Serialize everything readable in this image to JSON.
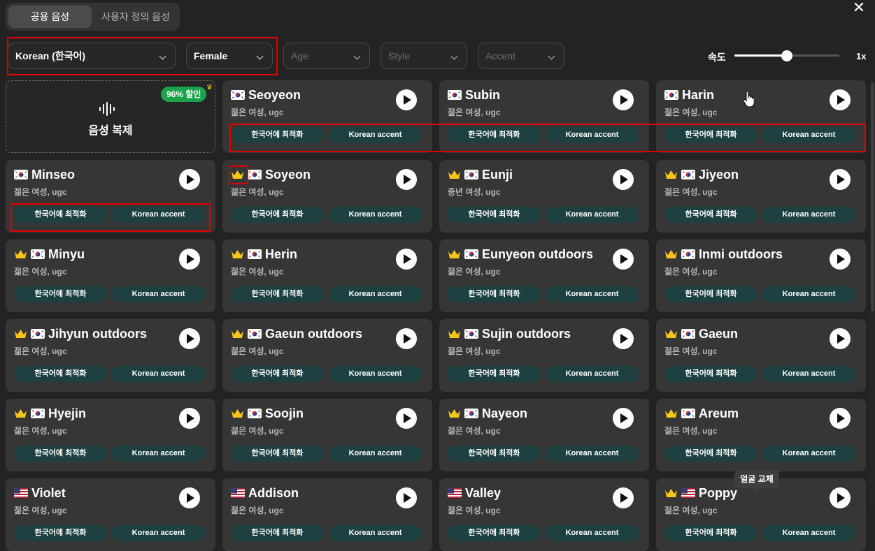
{
  "tabs": {
    "public": "공용 음성",
    "custom": "사용자 정의 음성"
  },
  "filters": {
    "language": "Korean (한국어)",
    "gender": "Female",
    "age_placeholder": "Age",
    "style_placeholder": "Style",
    "accent_placeholder": "Accent"
  },
  "speed": {
    "label": "속도",
    "value_text": "1x",
    "slider_fraction": 0.5
  },
  "clone": {
    "title": "음성 복제",
    "badge": "96% 할인"
  },
  "tooltip": "얼굴 교체",
  "tag_labels": [
    "한국어에 최적화",
    "Korean accent"
  ],
  "colors": {
    "tag_bg": "#1e4040",
    "badge_bg": "#1aa34a",
    "highlight": "#e00000",
    "card_bg": "#363636"
  },
  "voices": [
    {
      "name": "Seoyeon",
      "desc": "젊은 여성, ugc",
      "flag": "kr",
      "premium": false
    },
    {
      "name": "Subin",
      "desc": "젊은 여성, ugc",
      "flag": "kr",
      "premium": false
    },
    {
      "name": "Harin",
      "desc": "젊은 여성, ugc",
      "flag": "kr",
      "premium": false
    },
    {
      "name": "Minseo",
      "desc": "젊은 여성, ugc",
      "flag": "kr",
      "premium": false
    },
    {
      "name": "Soyeon",
      "desc": "젊은 여성, ugc",
      "flag": "kr",
      "premium": true
    },
    {
      "name": "Eunji",
      "desc": "중년 여성, ugc",
      "flag": "kr",
      "premium": true
    },
    {
      "name": "Jiyeon",
      "desc": "젊은 여성, ugc",
      "flag": "kr",
      "premium": true
    },
    {
      "name": "Minyu",
      "desc": "젊은 여성, ugc",
      "flag": "kr",
      "premium": true
    },
    {
      "name": "Herin",
      "desc": "젊은 여성, ugc",
      "flag": "kr",
      "premium": true
    },
    {
      "name": "Eunyeon outdoors",
      "desc": "젊은 여성, ugc",
      "flag": "kr",
      "premium": true
    },
    {
      "name": "Inmi outdoors",
      "desc": "젊은 여성, ugc",
      "flag": "kr",
      "premium": true
    },
    {
      "name": "Jihyun outdoors",
      "desc": "젊은 여성, ugc",
      "flag": "kr",
      "premium": true
    },
    {
      "name": "Gaeun outdoors",
      "desc": "젊은 여성, ugc",
      "flag": "kr",
      "premium": true
    },
    {
      "name": "Sujin outdoors",
      "desc": "젊은 여성, ugc",
      "flag": "kr",
      "premium": true
    },
    {
      "name": "Gaeun",
      "desc": "젊은 여성, ugc",
      "flag": "kr",
      "premium": true
    },
    {
      "name": "Hyejin",
      "desc": "젊은 여성, ugc",
      "flag": "kr",
      "premium": true
    },
    {
      "name": "Soojin",
      "desc": "젊은 여성, ugc",
      "flag": "kr",
      "premium": true
    },
    {
      "name": "Nayeon",
      "desc": "젊은 여성, ugc",
      "flag": "kr",
      "premium": true
    },
    {
      "name": "Areum",
      "desc": "젊은 여성, ugc",
      "flag": "kr",
      "premium": true
    },
    {
      "name": "Violet",
      "desc": "젊은 여성, ugc",
      "flag": "us",
      "premium": false
    },
    {
      "name": "Addison",
      "desc": "젊은 여성, ugc",
      "flag": "us",
      "premium": false
    },
    {
      "name": "Valley",
      "desc": "젊은 여성, ugc",
      "flag": "us",
      "premium": false
    },
    {
      "name": "Poppy",
      "desc": "젊은 여성, ugc",
      "flag": "us",
      "premium": true
    }
  ]
}
